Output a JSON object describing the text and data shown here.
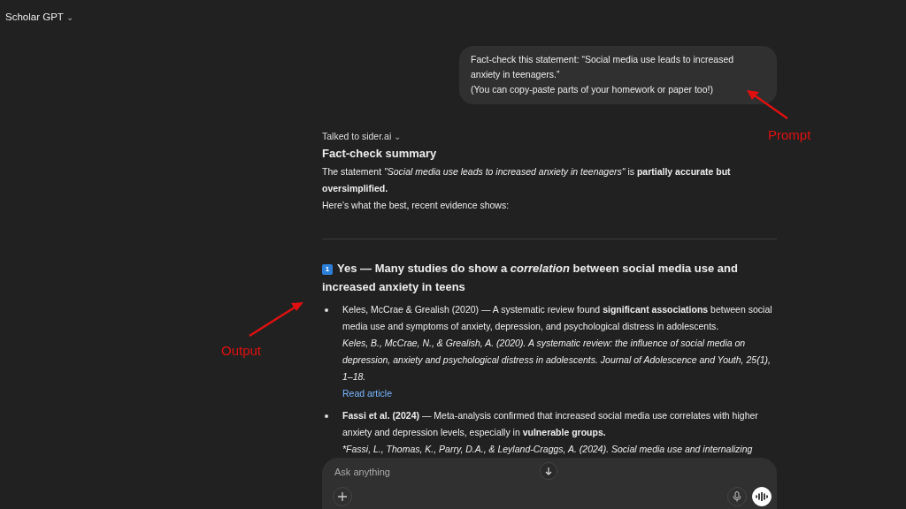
{
  "header": {
    "model": "Scholar GPT",
    "caret": "⌄"
  },
  "prompt": {
    "lines": [
      "Fact-check this statement: “Social media use leads to increased anxiety in teenagers.”",
      "(You can copy-paste parts of your homework or paper too!)"
    ]
  },
  "response": {
    "tool_note": "Talked to sider.ai",
    "tool_note_caret": "⌄",
    "summary_title": "Fact-check summary",
    "summary": "The statement *\"Social media use leads to increased anxiety in teenagers\"* is **partially accurate but oversimplified.**",
    "intro": "Here’s what the best, recent evidence shows:",
    "section": {
      "number": "1",
      "title": "Yes — Many studies do show a *correlation* between social media use and increased anxiety in teens"
    },
    "bullets": [
      {
        "text": "Keles, McCrae & Grealish (2020) — A systematic review found **significant associations** between social media use and symptoms of anxiety, depression, and psychological distress in adolescents.",
        "citation": "Keles, B., McCrae, N., & Grealish, A. (2020). A systematic review: the influence of social media on depression, anxiety and psychological distress in adolescents. Journal of Adolescence and Youth, 25(1), 1–18.",
        "link": "Read article"
      },
      {
        "text": "**Fassi et al. (2024)** — Meta-analysis confirmed that increased social media use correlates with higher anxiety and depression levels, especially in **vulnerable groups.**",
        "citation": "*Fassi, L., Thomas, K., Parry, D.A., & Leyland-Craggs, A. (2024). Social media use and internalizing"
      }
    ]
  },
  "composer": {
    "placeholder": "Ask anything"
  },
  "annotations": [
    {
      "kind": "prompt",
      "label": "Prompt"
    },
    {
      "kind": "output",
      "label": "Output"
    }
  ]
}
